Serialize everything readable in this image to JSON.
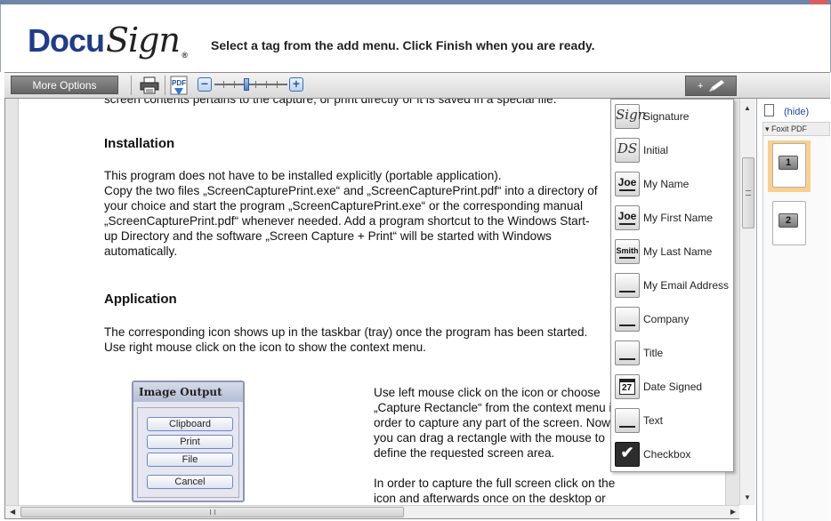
{
  "header": {
    "logo_primary": "Docu",
    "logo_secondary": "Sign",
    "logo_reg": "®",
    "message": "Select a tag from the add menu. Click Finish when you are ready."
  },
  "toolbar": {
    "more_options": "More Options",
    "zoom_minus": "−",
    "zoom_plus": "+",
    "add_tag_plus": "+",
    "zoom_level": 0.55,
    "pdf_label": "PDF"
  },
  "document": {
    "cut_line": "screen contents pertains to the capture, or print directly or it is saved in a special file.",
    "installation_heading": "Installation",
    "installation_lines": [
      "This program does not have to be installed explicitly (portable application).",
      "Copy the two files „ScreenCapturePrint.exe“ and „ScreenCapturePrint.pdf“ into a directory of",
      "your choice and start the program „ScreenCapturePrint.exe“ or the corresponding manual",
      "„ScreenCapturePrint.pdf“ whenever needed. Add a program shortcut to the Windows Start-",
      "up Directory and the software „Screen Capture + Print“ will be started with Windows",
      "automatically."
    ],
    "application_heading": "Application",
    "application_lines": [
      "The corresponding icon shows up in the taskbar (tray) once the program has been started.",
      "Use right mouse click on the icon to show the context menu."
    ],
    "capture_lines": [
      "Use left mouse click on the icon or choose",
      "„Capture Rectancle“ from the context menu in",
      "order to capture any part of the screen. Now",
      "you can drag a rectangle with the mouse to",
      "define the requested screen area."
    ],
    "fullscreen_lines": [
      "In order to capture the full screen click on the",
      "icon and afterwards once on the desktop or"
    ],
    "dialog": {
      "title": "Image Output",
      "buttons": [
        "Clipboard",
        "Print",
        "File",
        "Cancel"
      ]
    }
  },
  "tag_menu": [
    {
      "label": "Signature",
      "icon": "signature-icon",
      "glyph": "Sign"
    },
    {
      "label": "Initial",
      "icon": "initial-icon",
      "glyph": "DS"
    },
    {
      "label": "My Name",
      "icon": "name-icon",
      "glyph": "Joe"
    },
    {
      "label": "My First Name",
      "icon": "first-name-icon",
      "glyph": "Joe"
    },
    {
      "label": "My Last Name",
      "icon": "last-name-icon",
      "glyph": "Smith"
    },
    {
      "label": "My Email Address",
      "icon": "email-icon",
      "glyph": ""
    },
    {
      "label": "Company",
      "icon": "company-icon",
      "glyph": ""
    },
    {
      "label": "Title",
      "icon": "title-icon",
      "glyph": ""
    },
    {
      "label": "Date Signed",
      "icon": "calendar-icon",
      "glyph": "27"
    },
    {
      "label": "Text",
      "icon": "text-icon",
      "glyph": ""
    },
    {
      "label": "Checkbox",
      "icon": "checkbox-icon",
      "glyph": "✔"
    }
  ],
  "sidebar": {
    "hide_label": "(hide)",
    "foxit_label": "Foxit PDF",
    "pages": [
      "1",
      "2"
    ]
  },
  "scrollbars": {
    "grip_v": "≡",
    "grip_h": "III"
  },
  "colors": {
    "brand_blue": "#1f3b8a",
    "active_thumb": "#f9d08e",
    "link_blue": "#1f46a8"
  }
}
